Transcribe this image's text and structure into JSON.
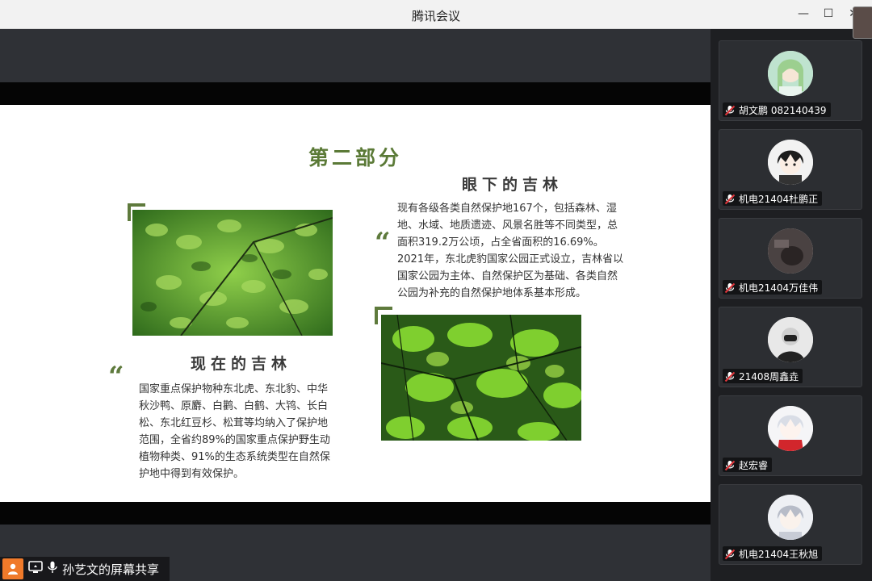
{
  "window": {
    "title": "腾讯会议",
    "controls": {
      "minimize": "—",
      "maximize": "☐",
      "close": "✕"
    }
  },
  "slide": {
    "part_title": "第二部分",
    "left": {
      "heading": "现在的吉林",
      "quote_mark": "“",
      "text": "国家重点保护物种东北虎、东北豹、中华秋沙鸭、原麝、白鹳、白鹤、大鸨、长白松、东北红豆杉、松茸等均纳入了保护地范围，全省约89%的国家重点保护野生动植物种类、91%的生态系统类型在自然保护地中得到有效保护。"
    },
    "right": {
      "heading": "眼下的吉林",
      "quote_mark": "“",
      "text": "现有各级各类自然保护地167个，包括森林、湿地、水域、地质遗迹、风景名胜等不同类型，总面积319.2万公顷，占全省面积的16.69%。2021年，东北虎豹国家公园正式设立，吉林省以国家公园为主体、自然保护区为基础、各类自然公园为补充的自然保护地体系基本形成。"
    },
    "accent_color": "#5e7a3c"
  },
  "participants": [
    {
      "name": "胡文鹏 082140439",
      "avatar": "anime-girl-avatar",
      "muted": true
    },
    {
      "name": "机电21404杜鹏正",
      "avatar": "anime-boy-avatar",
      "muted": true
    },
    {
      "name": "机电21404万佳伟",
      "avatar": "dark-photo-avatar",
      "muted": true
    },
    {
      "name": "21408周鑫垚",
      "avatar": "masked-person-avatar",
      "muted": true
    },
    {
      "name": "赵宏睿",
      "avatar": "white-hair-anime-avatar",
      "muted": true
    },
    {
      "name": "机电21404王秋旭",
      "avatar": "anime-portrait-avatar",
      "muted": true
    }
  ],
  "share_bar": {
    "label": "孙艺文的屏幕共享"
  },
  "colors": {
    "mute_red": "#e0353a",
    "share_orange": "#f07a2a"
  }
}
